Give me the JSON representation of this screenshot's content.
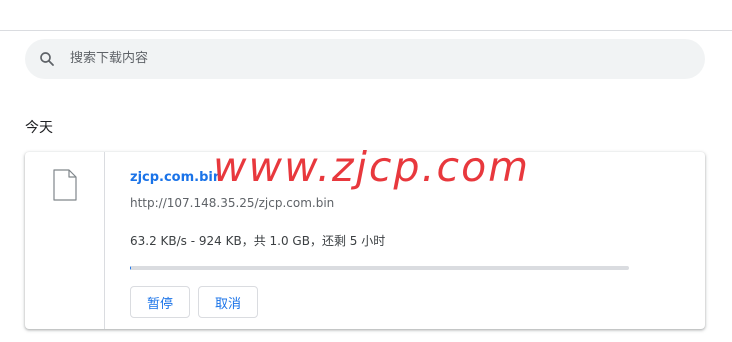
{
  "search": {
    "placeholder": "搜索下载内容",
    "icon": "search-icon"
  },
  "date_group": "今天",
  "download": {
    "file_name": "zjcp.com.bin",
    "url": "http://107.148.35.25/zjcp.com.bin",
    "status": "63.2 KB/s - 924 KB，共 1.0 GB，还剩 5 小时",
    "progress_fraction": 0.0009,
    "buttons": {
      "pause": "暂停",
      "cancel": "取消"
    },
    "icon": "file-icon"
  },
  "watermark": "www.zjcp.com",
  "colors": {
    "accent": "#1a73e8",
    "watermark": "#e8383d",
    "search_bg": "#f1f3f4"
  }
}
